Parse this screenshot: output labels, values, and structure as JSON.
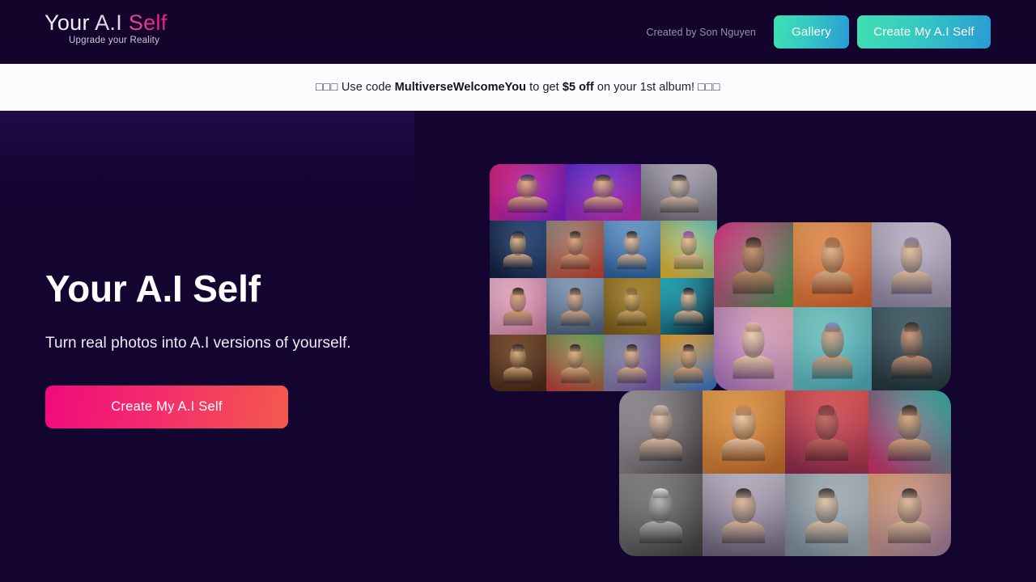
{
  "header": {
    "brand": {
      "word1": "Your",
      "word2": "A.I",
      "word3": "Self",
      "tagline": "Upgrade your Reality"
    },
    "credit": "Created by Son Nguyen",
    "gallery_label": "Gallery",
    "create_label": "Create My A.I Self"
  },
  "promo": {
    "emoji_left": "□□□",
    "text_1": " Use code ",
    "code": "MultiverseWelcomeYou",
    "text_2": " to get ",
    "discount": "$5 off",
    "text_3": " on your 1st album! ",
    "emoji_right": "□□□"
  },
  "hero": {
    "title": "Your A.I Self",
    "subtitle": "Turn real photos into A.I versions of yourself.",
    "cta_label": "Create My A.I Self"
  },
  "colors": {
    "page_background": "#140430",
    "header_background": "#13042b",
    "promo_background": "#fcfbfe",
    "brand_accent": "#ee2a86",
    "teal_button_start": "#3fe0b2",
    "teal_button_end": "#2a9ad6",
    "cta_start": "#f20a7c",
    "cta_end": "#f4594e",
    "heading_text": "#ffffff",
    "credit_text": "#9a90ad"
  },
  "collage": {
    "blocks": [
      {
        "name": "top-left-portrait-grid",
        "tiles": [
          {
            "bg1": "#e4247f",
            "bg2": "#7a1fd0",
            "skin": "#e0a878",
            "hair": "#1a2b6b",
            "span": 4
          },
          {
            "bg1": "#5f2fd8",
            "bg2": "#c02ab0",
            "skin": "#e2aa7e",
            "hair": "#241a33",
            "span": 4
          },
          {
            "bg1": "#b9b3c4",
            "bg2": "#6a6472",
            "skin": "#cfb49c",
            "hair": "#1d1a22",
            "span": 4
          },
          {
            "bg1": "#2d4f86",
            "bg2": "#101f3c",
            "skin": "#dfae85",
            "hair": "#1c1620",
            "span": 3
          },
          {
            "bg1": "#9a8d82",
            "bg2": "#c2402c",
            "skin": "#d89e72",
            "hair": "#2a1f1a",
            "span": 3
          },
          {
            "bg1": "#6fa4d6",
            "bg2": "#2c5f9e",
            "skin": "#e5b894",
            "hair": "#1b1d2c",
            "span": 3
          },
          {
            "bg1": "#67c9c0",
            "bg2": "#f0b429",
            "skin": "#e8b98d",
            "hair": "#a435d8",
            "span": 3
          },
          {
            "bg1": "#f0b9cf",
            "bg2": "#d17fa4",
            "skin": "#d99c6e",
            "hair": "#241a16",
            "span": 3
          },
          {
            "bg1": "#8ea6c6",
            "bg2": "#4c5f7c",
            "skin": "#d8a57e",
            "hair": "#3a3138",
            "span": 3
          },
          {
            "bg1": "#b8902f",
            "bg2": "#7a5c1c",
            "skin": "#d4aa62",
            "hair": "#8a6a28",
            "span": 3
          },
          {
            "bg1": "#23c4d8",
            "bg2": "#0a1a2e",
            "skin": "#e2b48c",
            "hair": "#14121a",
            "span": 3
          },
          {
            "bg1": "#7b4a2a",
            "bg2": "#46281a",
            "skin": "#d8a46c",
            "hair": "#2b2020",
            "span": 3
          },
          {
            "bg1": "#6fae5c",
            "bg2": "#c23b3b",
            "skin": "#dda878",
            "hair": "#22191c",
            "span": 3
          },
          {
            "bg1": "#8a97a8",
            "bg2": "#7a4fa8",
            "skin": "#e0ae82",
            "hair": "#201a24",
            "span": 3
          },
          {
            "bg1": "#f2a62c",
            "bg2": "#2f6fd0",
            "skin": "#d8a070",
            "hair": "#1a1520",
            "span": 3
          }
        ]
      },
      {
        "name": "middle-right-portrait-grid",
        "tiles": [
          {
            "bg1": "#e8348c",
            "bg2": "#3f9e52",
            "skin": "#c08a5c",
            "hair": "#2a1c18"
          },
          {
            "bg1": "#f0a05a",
            "bg2": "#d4612f",
            "skin": "#e0ad82",
            "hair": "#b86b35"
          },
          {
            "bg1": "#cfc6d8",
            "bg2": "#8d84a0",
            "skin": "#e4bb98",
            "hair": "#8f7fa8"
          },
          {
            "bg1": "#f0b8c0",
            "bg2": "#a86fc0",
            "skin": "#f0c9a8",
            "hair": "#f2c0ae"
          },
          {
            "bg1": "#7fd4cc",
            "bg2": "#4aa8b8",
            "skin": "#d4a07c",
            "hair": "#7f8fd0"
          },
          {
            "bg1": "#4a6670",
            "bg2": "#24353d",
            "skin": "#c89070",
            "hair": "#2a2320"
          }
        ]
      },
      {
        "name": "bottom-portrait-grid",
        "tiles": [
          {
            "bg1": "#a8a2a8",
            "bg2": "#4a4448",
            "skin": "#e0bb9c",
            "hair": "#d8c0a8"
          },
          {
            "bg1": "#f0a54c",
            "bg2": "#c06a2c",
            "skin": "#eec3a0",
            "hair": "#d48a40"
          },
          {
            "bg1": "#f05a5a",
            "bg2": "#8c2a4c",
            "skin": "#c06058",
            "hair": "#8a3030"
          },
          {
            "bg1": "#30b8a8",
            "bg2": "#d42c6c",
            "skin": "#d8a478",
            "hair": "#2a2018"
          },
          {
            "bg1": "#909090",
            "bg2": "#3c3c3c",
            "skin": "#b0b0b0",
            "hair": "#e8e8e8"
          },
          {
            "bg1": "#c8c0d0",
            "bg2": "#6a5f78",
            "skin": "#dcb496",
            "hair": "#2a2028"
          },
          {
            "bg1": "#b8c4cc",
            "bg2": "#7a8894",
            "skin": "#e0c0a4",
            "hair": "#3a2e28"
          },
          {
            "bg1": "#e8a878",
            "bg2": "#9a7a9a",
            "skin": "#dcb894",
            "hair": "#2e2420"
          }
        ]
      }
    ]
  }
}
